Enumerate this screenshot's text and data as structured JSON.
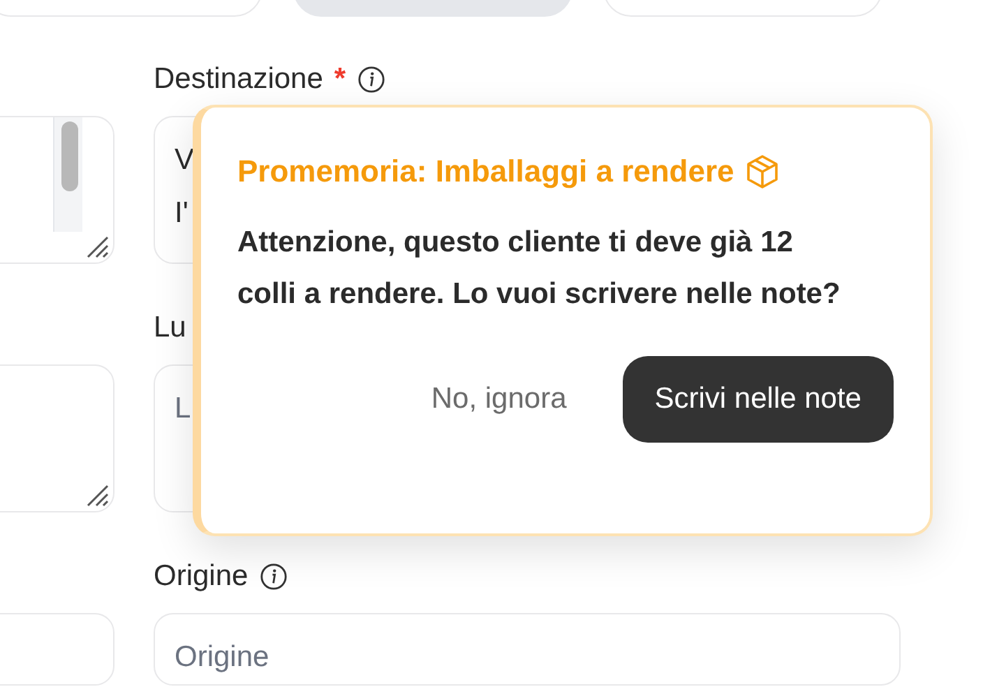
{
  "top_buttons": [
    {
      "selected": false
    },
    {
      "selected": true
    },
    {
      "selected": false
    }
  ],
  "fields": [
    {
      "label": "Destinazione",
      "required_mark": "*",
      "info_icon": true,
      "kind": "textarea",
      "value_lines": [
        "V",
        "I'"
      ]
    },
    {
      "label": "Lu",
      "kind": "textarea",
      "placeholder": "L"
    },
    {
      "label": "Origine",
      "info_icon": true,
      "kind": "input",
      "placeholder": "Origine"
    }
  ],
  "popover": {
    "title": "Promemoria: Imballaggi a rendere",
    "message": "Attenzione, questo cliente ti deve già 12 colli a rendere. Lo vuoi scrivere nelle note?",
    "buttons": [
      {
        "label": "No, ignora",
        "kind": "secondary"
      },
      {
        "label": "Scrivi nelle note",
        "kind": "primary"
      }
    ]
  }
}
